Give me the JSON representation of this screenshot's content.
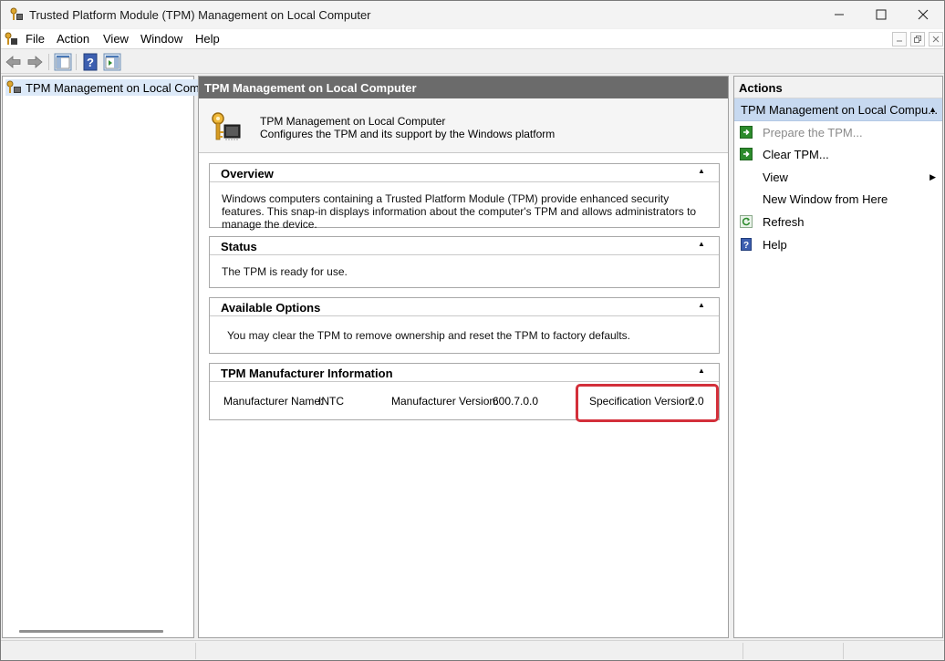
{
  "window": {
    "title": "Trusted Platform Module (TPM) Management on Local Computer",
    "minimize_icon": "minimize-icon",
    "maximize_icon": "maximize-icon",
    "close_icon": "close-icon"
  },
  "menu": {
    "items": [
      "File",
      "Action",
      "View",
      "Window",
      "Help"
    ]
  },
  "toolbar": {
    "buttons": [
      "back-arrow-icon",
      "forward-arrow-icon",
      "show-hide-console-tree-icon",
      "help-icon",
      "show-hide-action-pane-icon"
    ]
  },
  "tree": {
    "root_label": "TPM Management on Local Comp"
  },
  "center": {
    "header": "TPM Management on Local Computer",
    "intro_title": "TPM Management on Local Computer",
    "intro_desc": "Configures the TPM and its support by the Windows platform",
    "sections": {
      "overview": {
        "title": "Overview",
        "body": "Windows computers containing a Trusted Platform Module (TPM) provide enhanced security features. This snap-in displays information about the computer's TPM and allows administrators to manage the device."
      },
      "status": {
        "title": "Status",
        "body": "The TPM is ready for use."
      },
      "options": {
        "title": "Available Options",
        "body": "You may clear the TPM to remove ownership and reset the TPM to factory defaults."
      },
      "manufacturer": {
        "title": "TPM Manufacturer Information",
        "name_label": "Manufacturer Name:",
        "name_value": "INTC",
        "version_label": "Manufacturer Version:",
        "version_value": "600.7.0.0",
        "spec_label": "Specification Version:",
        "spec_value": "2.0"
      }
    }
  },
  "actions": {
    "title": "Actions",
    "group": "TPM Management on Local Compu...",
    "items": {
      "prepare": "Prepare the TPM...",
      "clear": "Clear TPM...",
      "view": "View",
      "new_window": "New Window from Here",
      "refresh": "Refresh",
      "help": "Help"
    }
  },
  "colors": {
    "highlight_border": "#d32f3a",
    "pane_header": "#6b6b6b",
    "selected_group": "#c7d9f0"
  }
}
